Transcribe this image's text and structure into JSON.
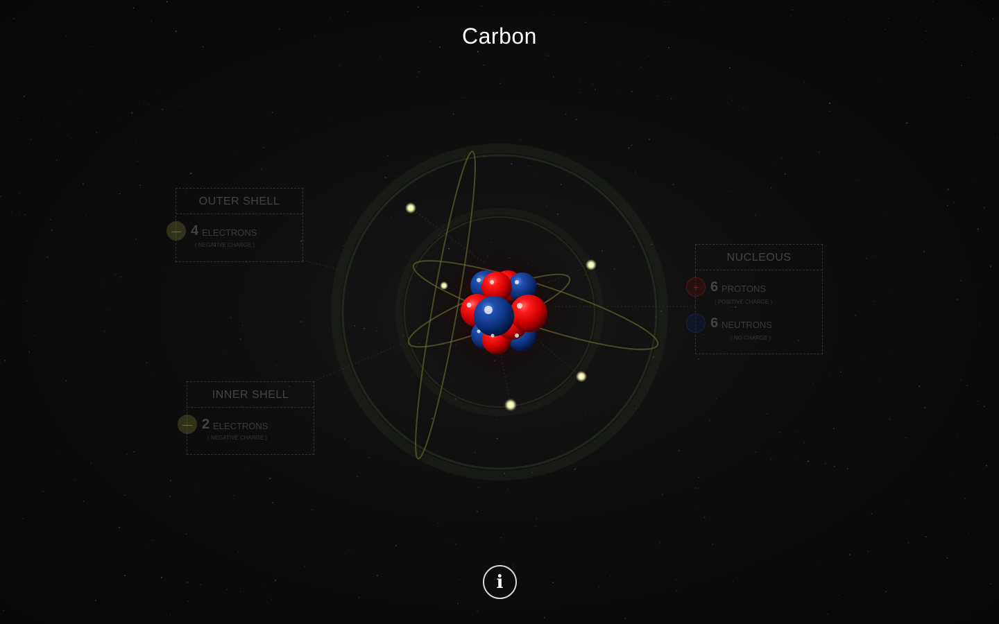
{
  "element": {
    "name": "Carbon"
  },
  "outer_shell": {
    "title": "OUTER SHELL",
    "count": "4",
    "unit": "ELECTRONS",
    "charge": "( NEGATIVE CHARGE )",
    "badge_symbol": "—"
  },
  "inner_shell": {
    "title": "INNER SHELL",
    "count": "2",
    "unit": "ELECTRONS",
    "charge": "( NEGATIVE CHARGE )",
    "badge_symbol": "—"
  },
  "nucleus": {
    "title": "NUCLEOUS",
    "protons": {
      "count": "6",
      "unit": "PROTONS",
      "charge": "( POSITIVE CHARGE )",
      "badge_symbol": "+"
    },
    "neutrons": {
      "count": "6",
      "unit": "NEUTRONS",
      "charge": "( NO CHARGE )"
    }
  },
  "info_button": {
    "label": "i"
  },
  "colors": {
    "proton": "#e00000",
    "neutron": "#0d3a91",
    "electron": "#ffffcc",
    "orbit": "#6b6b2a",
    "background": "#0a0a0a"
  }
}
